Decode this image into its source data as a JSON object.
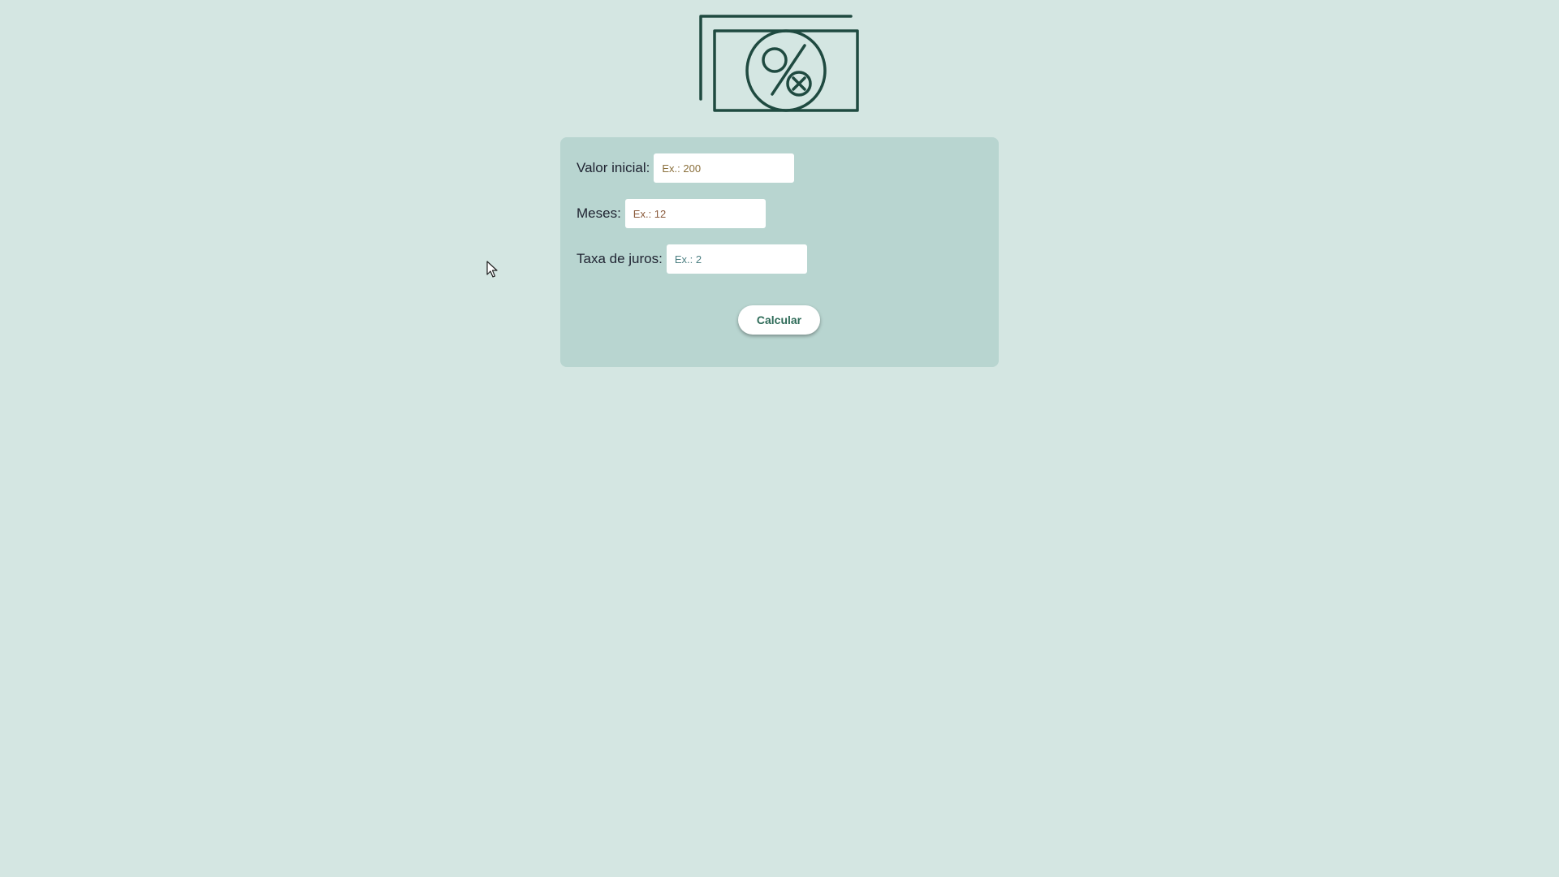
{
  "logo": {
    "icon": "money-bill-percent-icon",
    "color": "#1f4a40"
  },
  "form": {
    "fields": [
      {
        "label": "Valor inicial:",
        "placeholder": "Ex.: 200",
        "value": ""
      },
      {
        "label": "Meses:",
        "placeholder": "Ex.: 12",
        "value": ""
      },
      {
        "label": "Taxa de juros:",
        "placeholder": "Ex.: 2",
        "value": ""
      }
    ],
    "submit_label": "Calcular"
  },
  "colors": {
    "background": "#d4e6e2",
    "card": "#b8d5d0",
    "button_text": "#2e6b58",
    "icon": "#1f4a40"
  },
  "cursor": {
    "icon": "mouse-pointer-icon"
  }
}
